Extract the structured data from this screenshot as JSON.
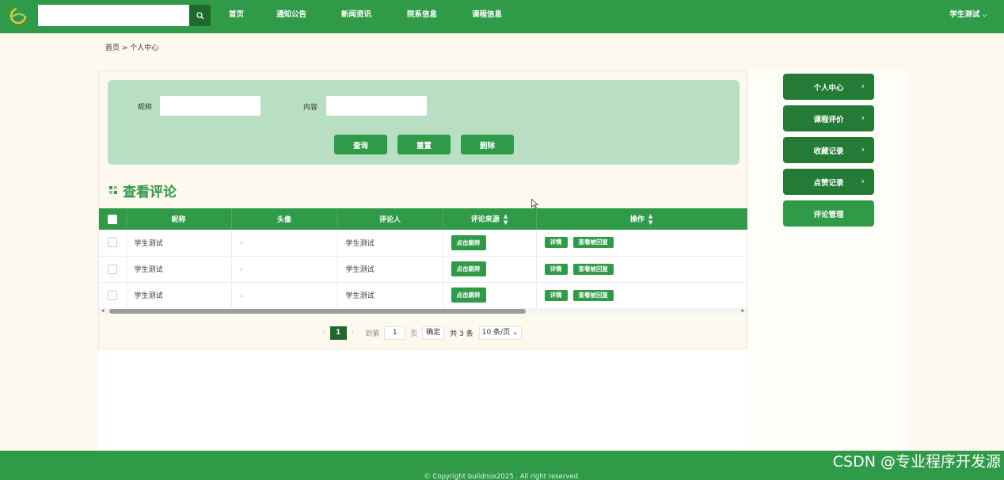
{
  "header": {
    "search_placeholder": "",
    "nav": [
      "首页",
      "通知公告",
      "新闻资讯",
      "院系信息",
      "课程信息"
    ],
    "user_label": "学生测试"
  },
  "breadcrumb": "首页 > 个人中心",
  "filter": {
    "nickname_label": "昵称",
    "content_label": "内容",
    "search_btn": "查询",
    "reset_btn": "重置",
    "delete_btn": "删除"
  },
  "section_title": "查看评论",
  "table": {
    "headers": [
      "昵称",
      "头像",
      "评论人",
      "评论来源",
      "操作"
    ],
    "rows": [
      {
        "nickname": "学生测试",
        "commenter": "学生测试",
        "source_btn": "点击跳转",
        "detail_btn": "详情",
        "reply_btn": "查看被回复"
      },
      {
        "nickname": "学生测试",
        "commenter": "学生测试",
        "source_btn": "点击跳转",
        "detail_btn": "详情",
        "reply_btn": "查看被回复"
      },
      {
        "nickname": "学生测试",
        "commenter": "学生测试",
        "source_btn": "点击跳转",
        "detail_btn": "详情",
        "reply_btn": "查看被回复"
      }
    ]
  },
  "pagination": {
    "current": "1",
    "goto_label": "到第",
    "goto_value": "1",
    "page_unit": "页",
    "confirm": "确定",
    "total": "共 3 条",
    "page_size": "10 条/页"
  },
  "sidebar": [
    "个人中心",
    "课程评价",
    "收藏记录",
    "点赞记录",
    "评论管理"
  ],
  "footer": {
    "copyright": "© Copyright buildnox2025 . All right reserved.",
    "watermark": "CSDN @专业程序开发源"
  }
}
